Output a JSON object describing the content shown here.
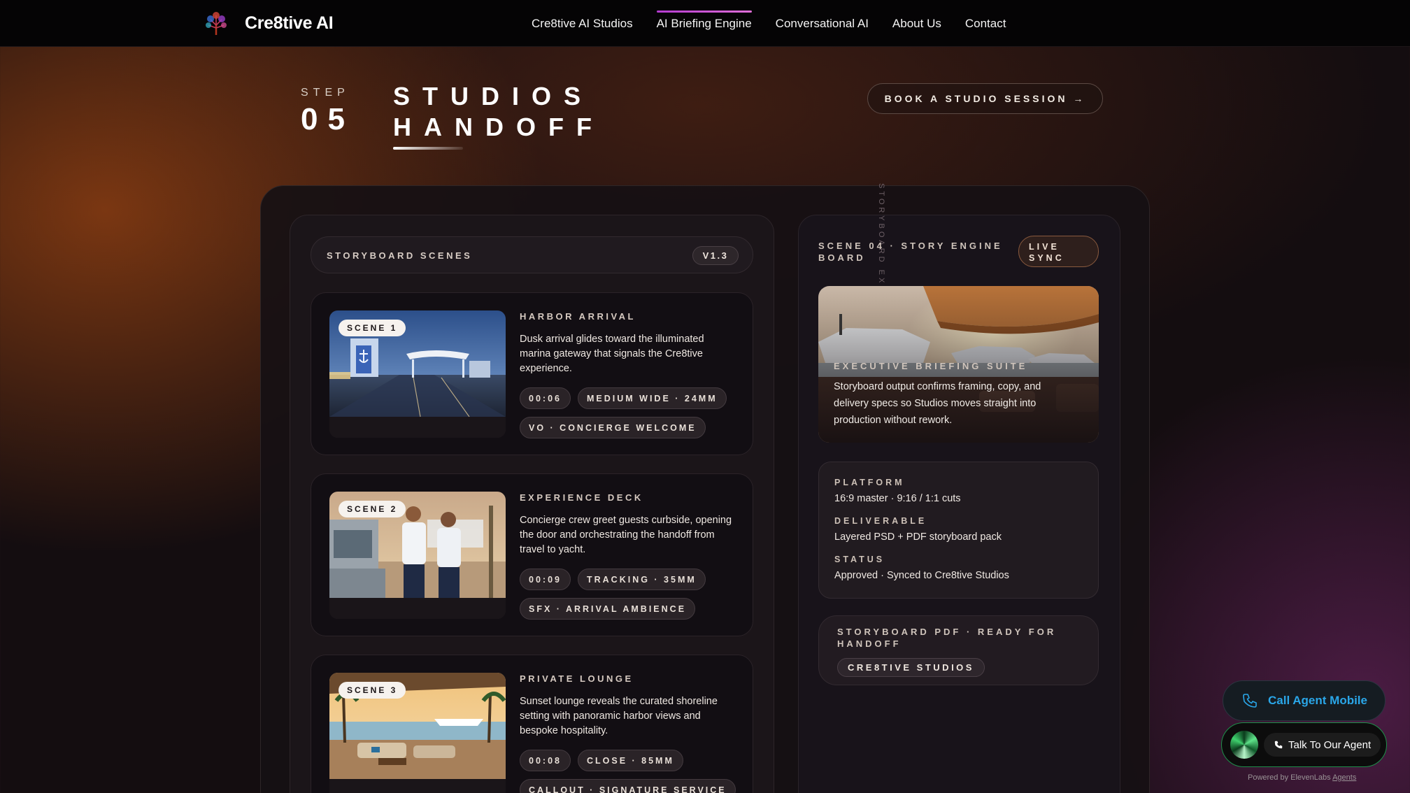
{
  "nav": {
    "brand": "Cre8tive AI",
    "links": [
      "Cre8tive AI Studios",
      "AI Briefing Engine",
      "Conversational AI",
      "About Us",
      "Contact"
    ],
    "active_index": 1
  },
  "header": {
    "step_label": "STEP",
    "step_number": "05",
    "title_line1": "STUDIOS",
    "title_line2": "HANDOFF",
    "cta": "BOOK A STUDIO SESSION →"
  },
  "storyboard": {
    "header_label": "STORYBOARD SCENES",
    "version": "V1.3",
    "scenes": [
      {
        "badge": "SCENE 1",
        "title": "HARBOR ARRIVAL",
        "desc": "Dusk arrival glides toward the illuminated marina gateway that signals the Cre8tive experience.",
        "chips": [
          "00:06",
          "MEDIUM WIDE · 24MM",
          "VO · CONCIERGE WELCOME"
        ]
      },
      {
        "badge": "SCENE 2",
        "title": "EXPERIENCE DECK",
        "desc": "Concierge crew greet guests curbside, opening the door and orchestrating the handoff from travel to yacht.",
        "chips": [
          "00:09",
          "TRACKING · 35MM",
          "SFX · ARRIVAL AMBIENCE"
        ]
      },
      {
        "badge": "SCENE 3",
        "title": "PRIVATE LOUNGE",
        "desc": "Sunset lounge reveals the curated shoreline setting with panoramic harbor views and bespoke hospitality.",
        "chips": [
          "00:08",
          "CLOSE · 85MM",
          "CALLOUT · SIGNATURE SERVICE"
        ]
      }
    ]
  },
  "board": {
    "title": "SCENE 04 · STORY ENGINE BOARD",
    "vertical": "STORYBOARD EX",
    "live": "LIVE SYNC",
    "hero_label": "EXECUTIVE BRIEFING SUITE",
    "hero_desc": "Storyboard output confirms framing, copy, and delivery specs so Studios moves straight into production without rework.",
    "platform_k": "PLATFORM",
    "platform_v": "16:9 master · 9:16 / 1:1 cuts",
    "deliverable_k": "DELIVERABLE",
    "deliverable_v": "Layered PSD + PDF storyboard pack",
    "status_k": "STATUS",
    "status_v": "Approved · Synced to Cre8tive Studios",
    "pdf_title": "STORYBOARD PDF · READY FOR HANDOFF",
    "pdf_chip": "CRE8TIVE STUDIOS"
  },
  "agent": {
    "call_mobile": "Call Agent Mobile",
    "talk": "Talk To Our Agent",
    "powered_prefix": "Powered by ElevenLabs",
    "powered_link": "Agents"
  }
}
